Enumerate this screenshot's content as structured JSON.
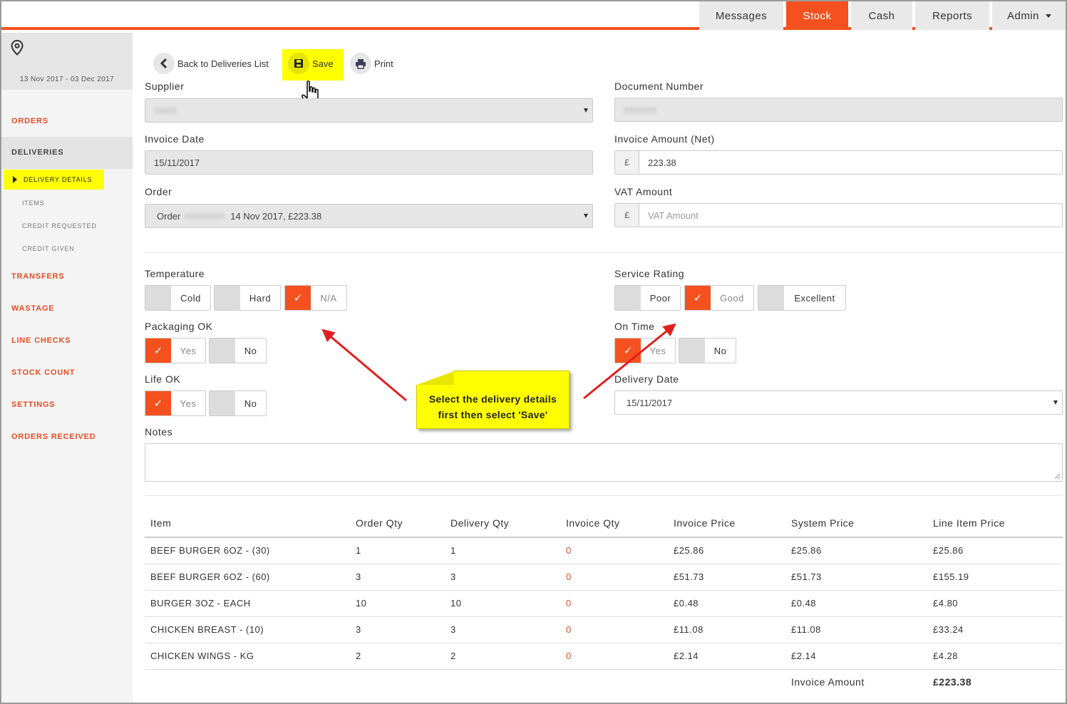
{
  "nav": {
    "tabs": [
      {
        "label": "Messages",
        "active": false
      },
      {
        "label": "Stock",
        "active": true
      },
      {
        "label": "Cash",
        "active": false
      },
      {
        "label": "Reports",
        "active": false
      },
      {
        "label": "Admin",
        "active": false
      }
    ]
  },
  "sidebar": {
    "date_range": "13 Nov 2017 - 03 Dec 2017",
    "items": {
      "orders": "ORDERS",
      "deliveries": "DELIVERIES",
      "transfers": "TRANSFERS",
      "wastage": "WASTAGE",
      "line_checks": "LINE CHECKS",
      "stock_count": "STOCK COUNT",
      "settings": "SETTINGS",
      "orders_received": "ORDERS RECEIVED"
    },
    "subitems": {
      "delivery_details": "DELIVERY DETAILS",
      "items": "ITEMS",
      "credit_requested": "CREDIT REQUESTED",
      "credit_given": "CREDIT GIVEN"
    }
  },
  "toolbar": {
    "back_label": "Back to Deliveries List",
    "save_label": "Save",
    "print_label": "Print"
  },
  "form": {
    "supplier_label": "Supplier",
    "document_number_label": "Document Number",
    "invoice_date_label": "Invoice Date",
    "invoice_date_value": "15/11/2017",
    "invoice_amount_label": "Invoice Amount (Net)",
    "currency_symbol": "£",
    "invoice_amount_value": "223.38",
    "order_label": "Order",
    "order_prefix": "Order",
    "order_value": "14 Nov 2017, £223.38",
    "vat_label": "VAT Amount",
    "vat_placeholder": "VAT Amount",
    "temperature_label": "Temperature",
    "temperature_options": [
      "Cold",
      "Hard",
      "N/A"
    ],
    "service_rating_label": "Service Rating",
    "service_rating_options": [
      "Poor",
      "Good",
      "Excellent"
    ],
    "packaging_label": "Packaging OK",
    "on_time_label": "On Time",
    "life_label": "Life OK",
    "yes": "Yes",
    "no": "No",
    "delivery_date_label": "Delivery Date",
    "delivery_date_value": "15/11/2017",
    "notes_label": "Notes",
    "check": "✓"
  },
  "table": {
    "headers": [
      "Item",
      "Order Qty",
      "Delivery Qty",
      "Invoice Qty",
      "Invoice Price",
      "System Price",
      "Line Item Price"
    ],
    "rows": [
      [
        "BEEF BURGER 6OZ - (30)",
        "1",
        "1",
        "0",
        "£25.86",
        "£25.86",
        "£25.86"
      ],
      [
        "BEEF BURGER 6OZ - (60)",
        "3",
        "3",
        "0",
        "£51.73",
        "£51.73",
        "£155.19"
      ],
      [
        "BURGER 3OZ - EACH",
        "10",
        "10",
        "0",
        "£0.48",
        "£0.48",
        "£4.80"
      ],
      [
        "CHICKEN BREAST - (10)",
        "3",
        "3",
        "0",
        "£11.08",
        "£11.08",
        "£33.24"
      ],
      [
        "CHICKEN WINGS - KG",
        "2",
        "2",
        "0",
        "£2.14",
        "£2.14",
        "£4.28"
      ]
    ],
    "total_label": "Invoice Amount",
    "total_value": "£223.38"
  },
  "annotation": {
    "line1": "Select the delivery details",
    "line2": "first then select 'Save'"
  },
  "colors": {
    "accent": "#f4511e",
    "highlight": "#ffff00",
    "sidebar_link": "#e84c23",
    "arrow": "#e02020"
  }
}
